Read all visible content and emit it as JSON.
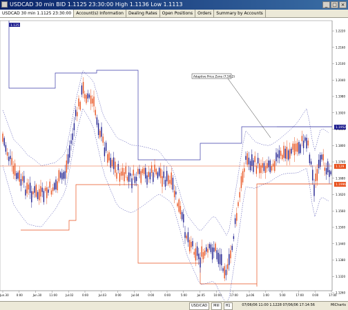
{
  "window": {
    "title": "USDCAD 30 min BID 1.1125 23:30:00 High 1.1136 Low 1.1113"
  },
  "tabs": [
    {
      "label": "USDCAD 30 min 1.1125 23:30:00"
    },
    {
      "label": "Account(s) Information"
    },
    {
      "label": "Dealing Rates"
    },
    {
      "label": "Open Positions"
    },
    {
      "label": "Orders"
    },
    {
      "label": "Summary by Accounts"
    }
  ],
  "chart": {
    "legend_badge": "1.125",
    "annotation": "Adaptive Price Zone (7,50,2)",
    "markers": {
      "top": "1.1952",
      "mid": "1.129",
      "bottom": "1.1996"
    },
    "price_labels": [
      "1.2220",
      "1.2160",
      "1.2100",
      "1.2040",
      "1.1980",
      "1.1920",
      "1.1860",
      "1.1800",
      "1.1740",
      "1.1680",
      "1.1620",
      "1.1560",
      "1.1500",
      "1.1440",
      "1.1380",
      "1.1320",
      "1.1260"
    ],
    "date_labels": [
      "Jun.30",
      "0:00",
      "Jun.30",
      "11:00",
      "Jul.02",
      "0:00",
      "Jul.03",
      "0:00",
      "Jul.04",
      "0:00",
      "0:00",
      "5:00",
      "Jul.05",
      "10:00",
      "17:00",
      "Jul.06",
      "1:00",
      "5:00",
      "17:00",
      "0:00",
      "17:00"
    ]
  },
  "bottombar": {
    "pair": "USD/CAD",
    "timeframe": "Mill",
    "pips": "H1",
    "timestamp": "07/06/06 11:00",
    "price": "1.1228",
    "date": "07/06/06 11:00",
    "close": "1.1228",
    "time": "07/06/06 17:14:56",
    "marker": "MiCharts"
  },
  "colors": {
    "upcandle": "#1f1f8f",
    "downcandle": "#e8501c",
    "zone_upper": "#3a3aa8",
    "zone_lower": "#e8501c",
    "dotted": "#3a3aa8"
  }
}
